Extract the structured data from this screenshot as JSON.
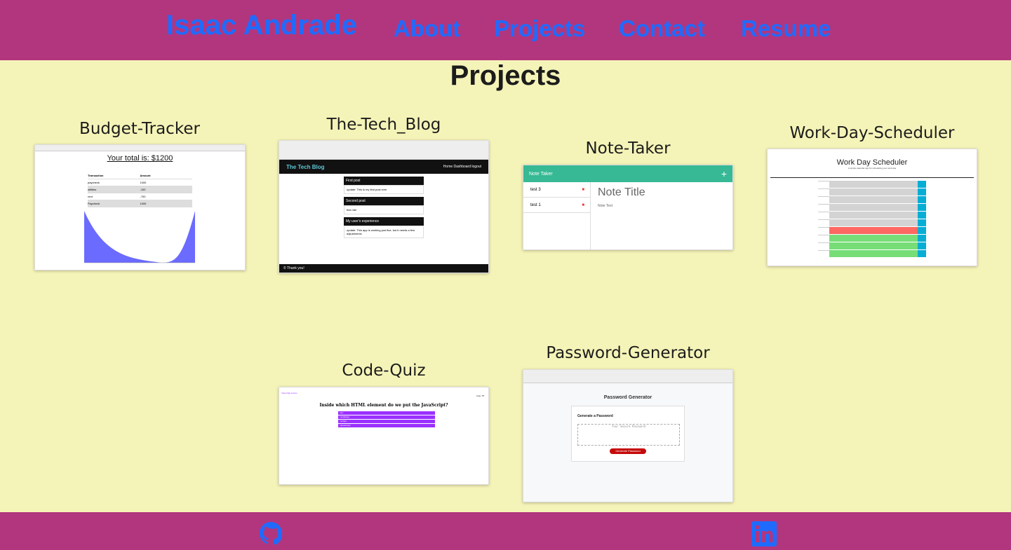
{
  "nav": {
    "brand": "Isaac Andrade",
    "about": "About",
    "projects": "Projects",
    "contact": "Contact",
    "resume": "Resume"
  },
  "page_title": "Projects",
  "projects": [
    {
      "title": "Budget-Tracker",
      "screenshot": {
        "total": "Your total is: $1200",
        "rows": [
          [
            "Transaction",
            "Amount"
          ],
          [
            "paycheck",
            "1000"
          ],
          [
            "utilities",
            "-100"
          ],
          [
            "rent",
            "-700"
          ],
          [
            "Paycheck",
            "1000"
          ]
        ]
      }
    },
    {
      "title": "The-Tech_Blog",
      "screenshot": {
        "header": "The Tech Blog",
        "nav_links": "Home  Dashboard  logout",
        "posts": [
          {
            "title": "First post",
            "body": "update: This is my first post ever"
          },
          {
            "title": "Second post",
            "body": "first ride"
          },
          {
            "title": "My user's experience",
            "body": "update: This app is working just fine, but it needs a few adjustments"
          }
        ],
        "footer": "© Thank you!"
      }
    },
    {
      "title": "Note-Taker",
      "screenshot": {
        "header": "Note Taker",
        "notes": [
          "test 3",
          "test 1"
        ],
        "note_title": "Note Title",
        "note_text": "Note Text"
      }
    },
    {
      "title": "Work-Day-Scheduler",
      "screenshot": {
        "title": "Work Day Scheduler",
        "subtitle": "A simple calendar app for scheduling your work day"
      }
    },
    {
      "title": "Code-Quiz",
      "screenshot": {
        "link": "View high scores",
        "time": "time: 75",
        "question": "Inside which HTML element do we put the JavaScript?",
        "answers": [
          "<js>",
          "<scripting>",
          "<script>",
          "<javascript>"
        ]
      }
    },
    {
      "title": "Password-Generator",
      "screenshot": {
        "title": "Password Generator",
        "card_title": "Generate a Password",
        "placeholder": "Your Secure Password",
        "button": "Generate Password"
      }
    }
  ],
  "footer": {
    "github": "github-icon",
    "linkedin": "linkedin-icon"
  },
  "colors": {
    "nav_bg": "#b1367e",
    "page_bg": "#f5f4b8",
    "link": "#1f6bff"
  }
}
